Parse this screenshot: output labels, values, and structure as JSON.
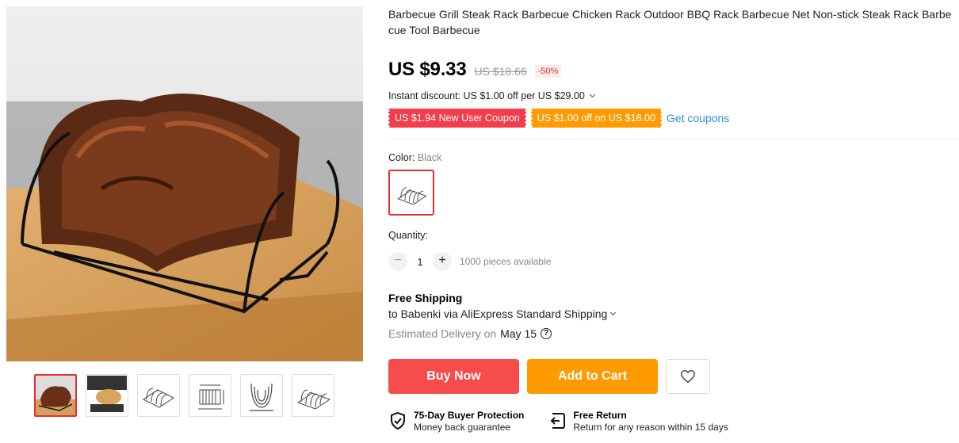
{
  "product": {
    "title": "Barbecue Grill Steak Rack Barbecue Chicken Rack Outdoor BBQ Rack Barbecue Net Non-stick Steak Rack Barbecue Tool Barbecue",
    "price": "US $9.33",
    "original_price": "US $18.66",
    "discount": "-50%"
  },
  "promotions": {
    "instant_discount": "Instant discount: US $1.00 off per US $29.00",
    "coupons": [
      {
        "label": "US $1.94 New User Coupon",
        "color": "#f23d4b"
      },
      {
        "label": "US $1.00 off on US $18.00",
        "color": "#ff9a00"
      }
    ],
    "get_coupons": "Get coupons"
  },
  "variant": {
    "color_label": "Color:",
    "color_value": "Black",
    "swatch_icon": "rack-thumbnail"
  },
  "quantity": {
    "label": "Quantity:",
    "minus": "−",
    "value": "1",
    "plus": "+",
    "available": "1000 pieces available"
  },
  "shipping": {
    "title": "Free Shipping",
    "via": "to Babenki via AliExpress Standard Shipping",
    "estimated_label": "Estimated Delivery on",
    "date": "May 15",
    "help_icon": "?"
  },
  "actions": {
    "buy_now": "Buy Now",
    "add_to_cart": "Add to Cart",
    "wishlist_icon": "heart-icon"
  },
  "guarantees": [
    {
      "title": "75-Day Buyer Protection",
      "subtitle": "Money back guarantee",
      "icon": "shield-check-icon"
    },
    {
      "title": "Free Return",
      "subtitle": "Return for any reason within 15 days",
      "icon": "return-icon"
    }
  ],
  "gallery": {
    "thumbnails": [
      "ribs-on-rack",
      "chicken-on-rack",
      "rack-angle-view",
      "rack-dimensions",
      "rack-front-view",
      "rack-side-view"
    ],
    "active_index": 0
  },
  "colors": {
    "accent_red": "#e62e2e",
    "buy_now": "#f64c4c",
    "orange": "#ff9a00",
    "link_blue": "#2e8eda"
  }
}
